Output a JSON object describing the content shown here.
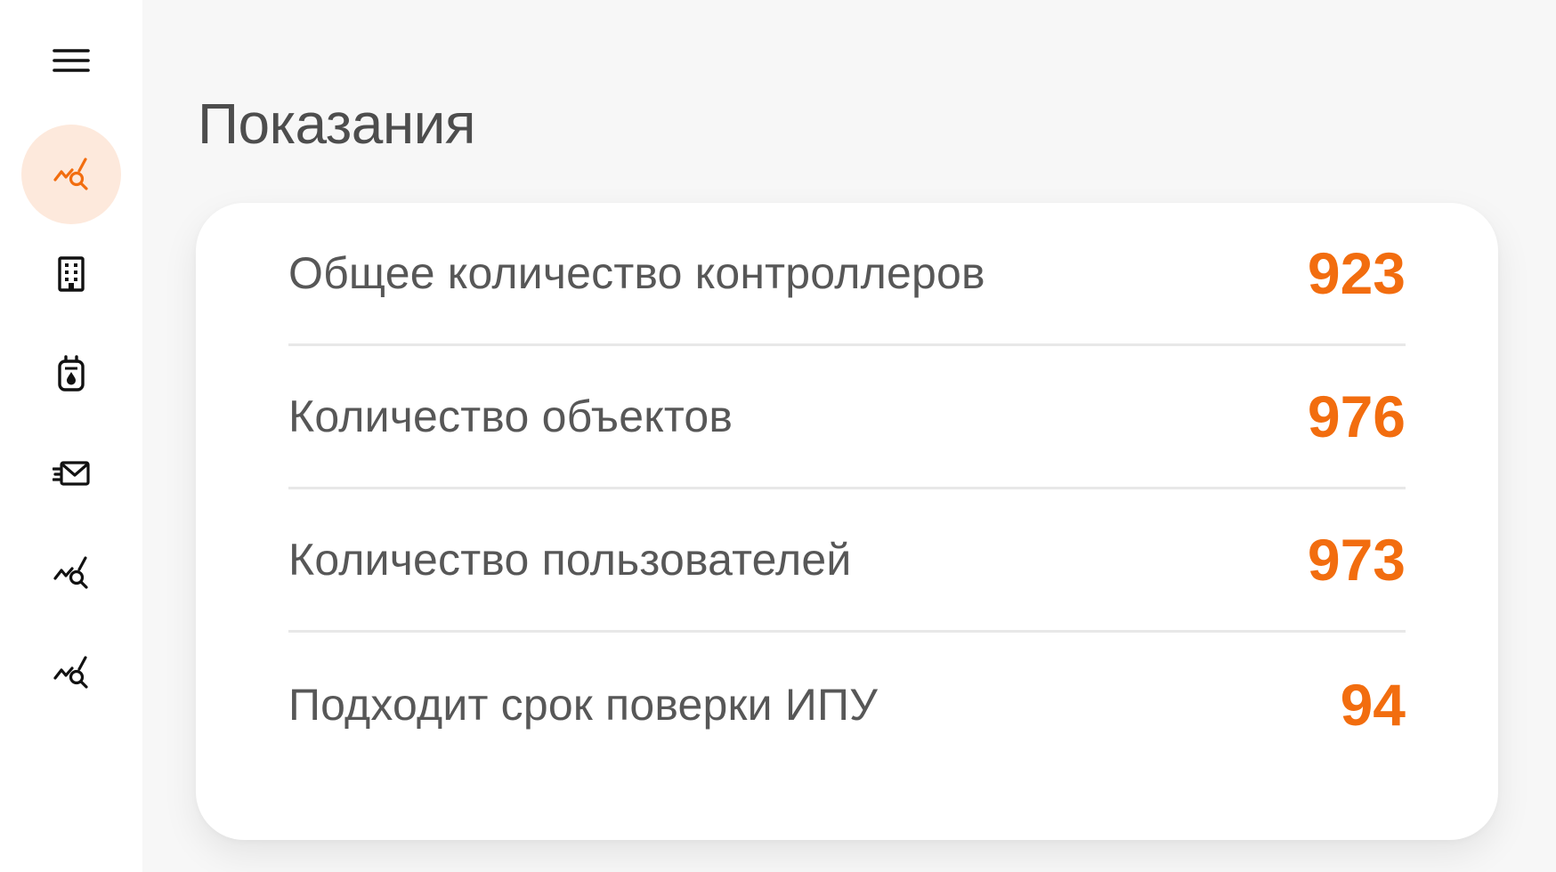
{
  "page": {
    "title": "Показания"
  },
  "sidebar": {
    "items": [
      {
        "icon": "hamburger-menu-icon",
        "active": false
      },
      {
        "icon": "chart-search-icon",
        "active": true
      },
      {
        "icon": "building-icon",
        "active": false
      },
      {
        "icon": "meter-device-icon",
        "active": false
      },
      {
        "icon": "mail-send-icon",
        "active": false
      },
      {
        "icon": "chart-search-icon",
        "active": false
      },
      {
        "icon": "chart-search-icon",
        "active": false
      }
    ]
  },
  "stats": [
    {
      "label": "Общее количество контроллеров",
      "value": "923"
    },
    {
      "label": "Количество объектов",
      "value": "976"
    },
    {
      "label": "Количество пользователей",
      "value": "973"
    },
    {
      "label": "Подходит срок поверки ИПУ",
      "value": "94"
    }
  ],
  "colors": {
    "accent": "#f26d0f",
    "active_bg": "#fde9dc",
    "text": "#575757",
    "icon": "#111111"
  }
}
